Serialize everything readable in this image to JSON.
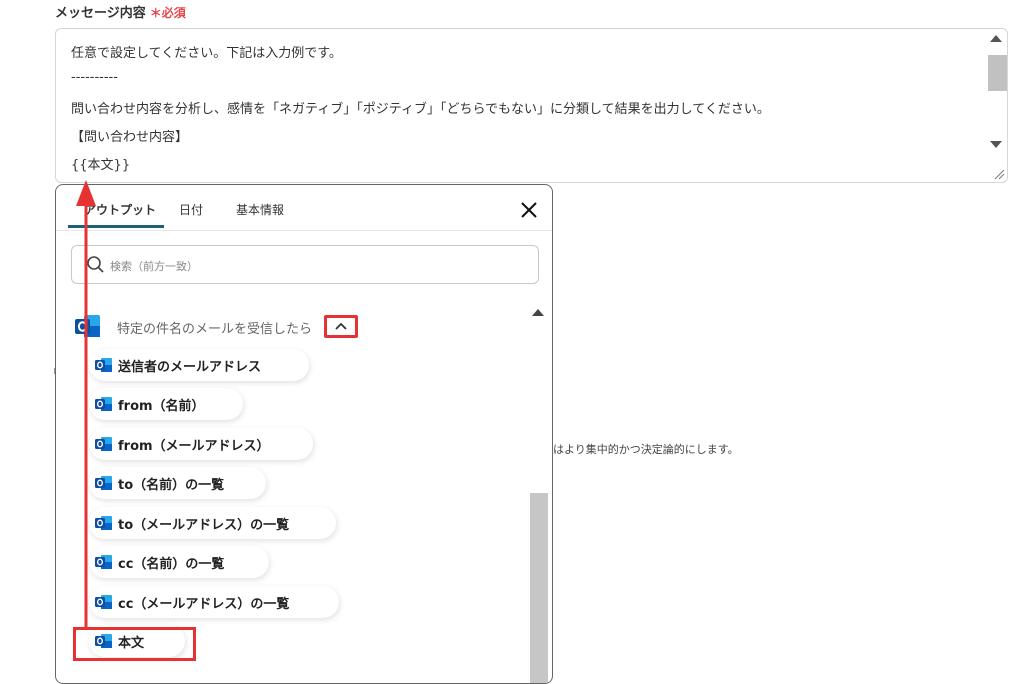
{
  "field": {
    "label": "メッセージ内容",
    "required_mark": "＊必須"
  },
  "textarea": {
    "lines": [
      "任意で設定してください。下記は入力例です。",
      "----------",
      "問い合わせ内容を分析し、感情を「ネガティブ」「ポジティブ」「どちらでもない」に分類して結果を出力してください。",
      "【問い合わせ内容】",
      "{{本文}}"
    ]
  },
  "background_hint": "はより集中的かつ決定論的にします。",
  "popup": {
    "tabs": [
      "アウトプット",
      "日付",
      "基本情報"
    ],
    "active_tab": "アウトプット",
    "search_placeholder": "検索（前方一致）",
    "group_label": "特定の件名のメールを受信したら",
    "items": [
      "送信者のメールアドレス",
      "from（名前）",
      "from（メールアドレス）",
      "to（名前）の一覧",
      "to（メールアドレス）の一覧",
      "cc（名前）の一覧",
      "cc（メールアドレス）の一覧",
      "本文"
    ]
  },
  "colors": {
    "highlight": "#e53232",
    "outlook_blue": "#0a64c8",
    "tab_underline": "#1f5f7a",
    "required": "#e5484d"
  },
  "icons": [
    "outlook-icon",
    "search-icon",
    "close-icon",
    "chevron-up-icon",
    "resize-grip-icon"
  ]
}
